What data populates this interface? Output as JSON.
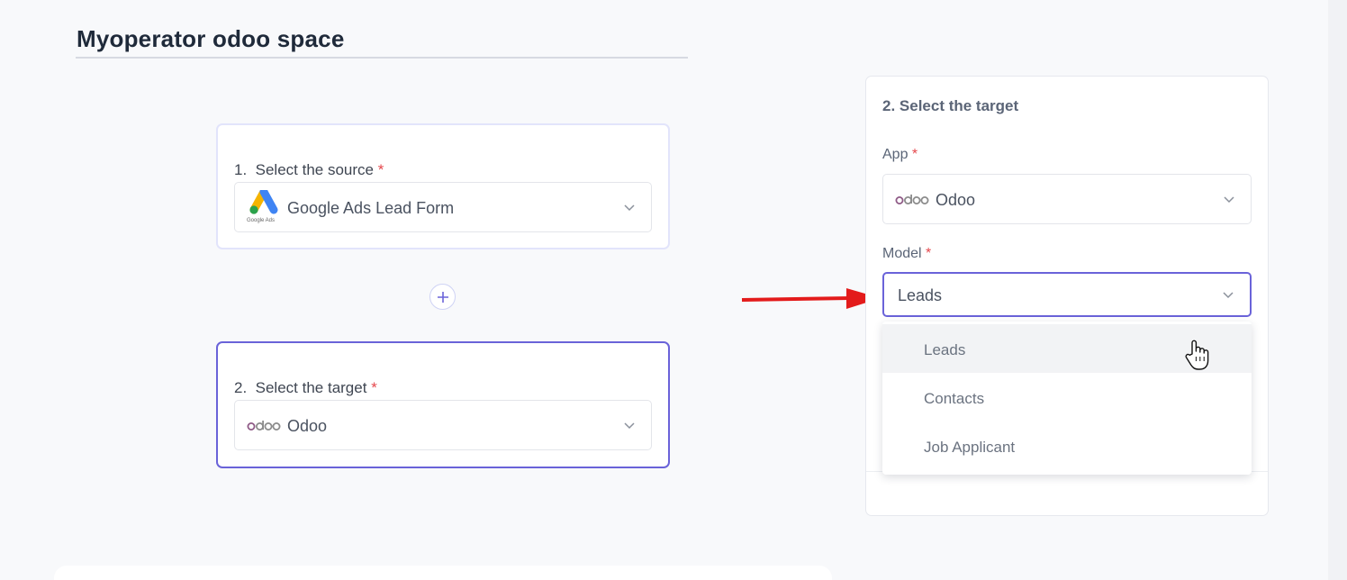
{
  "page": {
    "title": "Myoperator odoo space"
  },
  "source_card": {
    "number": "1.",
    "label": "Select the source",
    "required_mark": "*",
    "selected_app": "Google Ads Lead Form",
    "icon": "google-ads-logo",
    "icon_caption": "Google Ads"
  },
  "add_step": {
    "label": "+"
  },
  "target_card": {
    "number": "2.",
    "label": "Select the target",
    "required_mark": "*",
    "selected_app": "Odoo",
    "icon": "odoo-logo"
  },
  "target_panel": {
    "title": "2. Select the target",
    "app_label": "App",
    "app_required": "*",
    "app_value": "Odoo",
    "model_label": "Model",
    "model_required": "*",
    "model_value": "Leads"
  },
  "model_dropdown": {
    "options": [
      {
        "label": "Leads",
        "highlighted": true
      },
      {
        "label": "Contacts",
        "highlighted": false
      },
      {
        "label": "Job Applicant",
        "highlighted": false
      }
    ]
  },
  "colors": {
    "accent": "#6a63d9",
    "required": "#e5484d",
    "arrow": "#e31b1b",
    "odoo_purple": "#8f5b87"
  }
}
